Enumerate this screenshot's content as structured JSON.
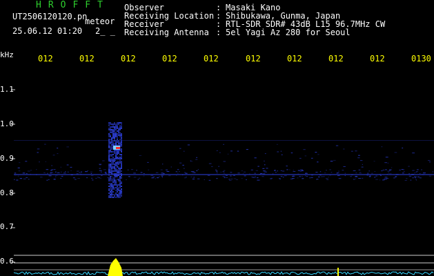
{
  "header": {
    "brand": "HROFFT",
    "filename": "UT2506120120.pn",
    "filetype": "meteor",
    "datetime": "25.06.12 01:20",
    "datetime_extra": "2_ _"
  },
  "info": [
    {
      "label": "Observer",
      "value": "Masaki Kano"
    },
    {
      "label": "Receiving Location",
      "value": "Shibukawa, Gunma, Japan"
    },
    {
      "label": "Receiver",
      "value": "RTL-SDR SDR# 43dB L15 96.7MHz CW"
    },
    {
      "label": "Receiving Antenna",
      "value": "5el Yagi Az 280 for Seoul"
    }
  ],
  "x_ticks": [
    "012",
    "012",
    "012",
    "012",
    "012",
    "012",
    "012",
    "012",
    "012",
    "0130"
  ],
  "y_unit": "kHz",
  "y_ticks": [
    "1.1",
    "1.0",
    "0.9",
    "0.8",
    "0.7",
    "0.6"
  ],
  "colors": {
    "label_white": "#ffffff",
    "brand_green": "#2ecf2e",
    "info_yellow": "#ffff00",
    "signal_blue": "#2a3cd0",
    "peak_red": "#ff2a2a",
    "audio_cyan": "#36d6ff",
    "audio_yellow": "#ffff00"
  }
}
